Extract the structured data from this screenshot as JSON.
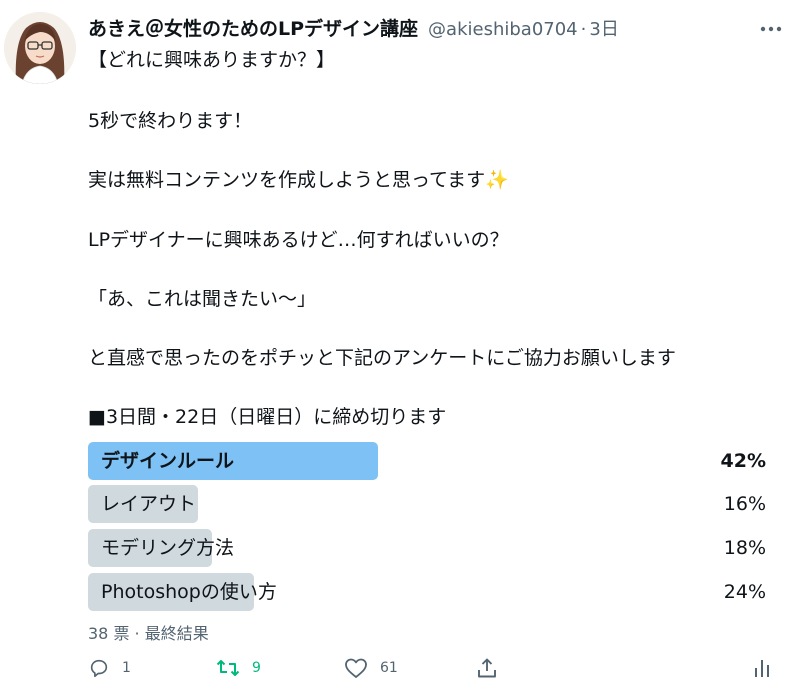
{
  "author": {
    "name": "あきえ＠女性のためのLPデザイン講座",
    "handle": "@akieshiba0704",
    "separator": "·",
    "time": "3日"
  },
  "body": [
    "【どれに興味ありますか？】",
    "5秒で終わります！",
    "実は無料コンテンツを作成しようと思ってます✨",
    "LPデザイナーに興味あるけど…何すればいいの？",
    "「あ、これは聞きたい〜」",
    "と直感で思ったのをポチッと下記のアンケートにご協力お願いします",
    "■3日間・22日（日曜日）に締め切ります"
  ],
  "poll": {
    "options": [
      {
        "label": "デザインルール",
        "percent": "42%",
        "fraction": 0.42,
        "winner": true
      },
      {
        "label": "レイアウト",
        "percent": "16%",
        "fraction": 0.16,
        "winner": false
      },
      {
        "label": "モデリング方法",
        "percent": "18%",
        "fraction": 0.18,
        "winner": false
      },
      {
        "label": "Photoshopの使い方",
        "percent": "24%",
        "fraction": 0.24,
        "winner": false
      }
    ],
    "meta": "38 票 · 最終結果"
  },
  "actions": {
    "reply": "1",
    "retweet": "9",
    "like": "61"
  },
  "colors": {
    "winner_bar": "#7dc1f5",
    "bar": "#cfd9de",
    "retweet": "#00ba7c",
    "secondary_text": "#536471"
  }
}
